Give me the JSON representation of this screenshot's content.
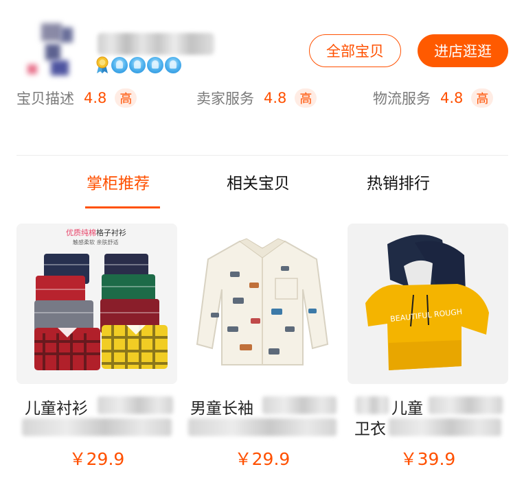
{
  "shop": {
    "all_items_label": "全部宝贝",
    "enter_shop_label": "进店逛逛",
    "ratings": [
      {
        "label": "宝贝描述",
        "score": "4.8",
        "level": "高"
      },
      {
        "label": "卖家服务",
        "score": "4.8",
        "level": "高"
      },
      {
        "label": "物流服务",
        "score": "4.8",
        "level": "高"
      }
    ],
    "crown_count": 4
  },
  "tabs": [
    {
      "label": "掌柜推荐",
      "active": true
    },
    {
      "label": "相关宝贝",
      "active": false
    },
    {
      "label": "热销排行",
      "active": false
    }
  ],
  "products": [
    {
      "image_caption_top": "优质纯棉",
      "image_caption_top2": "格子衬衫",
      "image_caption_sub": "触感柔软 亲肤舒适",
      "title_visible": "儿童衬衫",
      "price": "￥29.9"
    },
    {
      "title_visible": "男童长袖",
      "price": "￥29.9"
    },
    {
      "image_hoodie_text": "BEAUTIFUL ROUGH",
      "title_visible_a": "儿童",
      "title_visible_b": "卫衣",
      "price": "￥39.9"
    }
  ],
  "colors": {
    "accent": "#ff5000",
    "rating_tag_bg": "#ffece4",
    "label_gray": "#7a7a7a"
  }
}
